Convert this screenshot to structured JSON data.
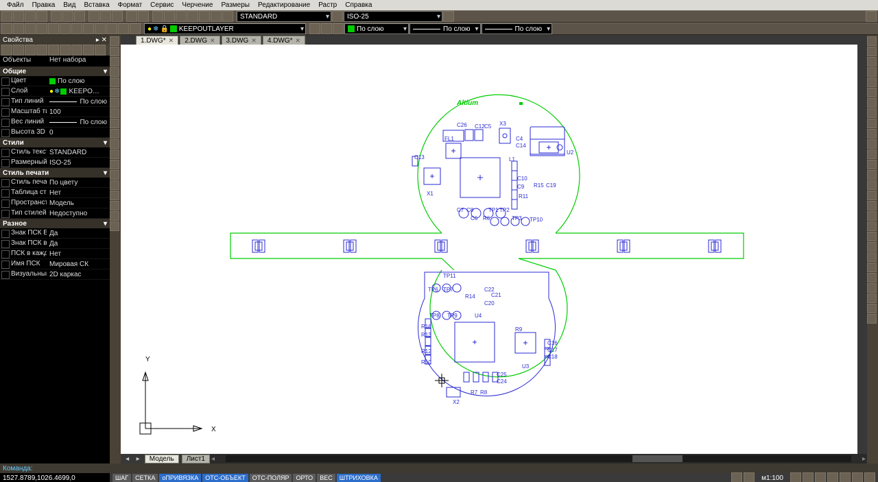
{
  "menu": [
    "Файл",
    "Правка",
    "Вид",
    "Вставка",
    "Формат",
    "Сервис",
    "Черчение",
    "Размеры",
    "Редактирование",
    "Растр",
    "Справка"
  ],
  "toolbar2": {
    "style_combo": "STANDARD",
    "dim_combo": "ISO-25"
  },
  "toolbar3": {
    "layer": "KEEPOUTLAYER",
    "bylayer": "По слою",
    "linetype": "По слою",
    "lineweight": "По слою"
  },
  "panel": {
    "title": "Свойства",
    "objects_lbl": "Объекты",
    "objects_val": "Нет набора",
    "sections": {
      "general": "Общие",
      "styles": "Стили",
      "plotstyle": "Стиль печати",
      "misc": "Разное"
    },
    "general": [
      {
        "k": "Цвет",
        "v": "По слою",
        "swatch": "#0c0"
      },
      {
        "k": "Слой",
        "v": "KEEPO…",
        "swatch": "#0c0",
        "layer": true
      },
      {
        "k": "Тип линий",
        "v": "По слою",
        "line": true
      },
      {
        "k": "Масштаб типа …",
        "v": "100"
      },
      {
        "k": "Вес линий",
        "v": "По слою",
        "line": true
      },
      {
        "k": "Высота 3D",
        "v": "0"
      }
    ],
    "styles": [
      {
        "k": "Стиль текста",
        "v": "STANDARD"
      },
      {
        "k": "Размерный ст…",
        "v": "ISO-25"
      }
    ],
    "plotstyle": [
      {
        "k": "Стиль печати",
        "v": "По цвету"
      },
      {
        "k": "Таблица стиле…",
        "v": "Нет"
      },
      {
        "k": "Пространство …",
        "v": "Модель"
      },
      {
        "k": "Тип стилей печ…",
        "v": "Недоступно"
      }
    ],
    "misc": [
      {
        "k": "Знак ПСК Вкл",
        "v": "Да"
      },
      {
        "k": "Знак ПСК в на…",
        "v": "Да"
      },
      {
        "k": "ПСК в каждом …",
        "v": "Нет"
      },
      {
        "k": "Имя ПСК",
        "v": "Мировая СК"
      },
      {
        "k": "Визуальный ст…",
        "v": "2D каркас"
      }
    ]
  },
  "tabs": [
    {
      "label": "1.DWG*",
      "active": true
    },
    {
      "label": "2.DWG"
    },
    {
      "label": "3.DWG"
    },
    {
      "label": "4.DWG*"
    }
  ],
  "bottom_tabs": [
    {
      "label": "Модель",
      "active": true
    },
    {
      "label": "Лист1"
    }
  ],
  "drawing": {
    "brand": "Altium",
    "axes": {
      "x": "X",
      "y": "Y"
    },
    "top_refs": [
      "C26",
      "FL1",
      "C12",
      "C5",
      "X3",
      "C4",
      "C14",
      "U2",
      "C13",
      "L1",
      "X1",
      "C10",
      "C9",
      "R15",
      "C19",
      "R11",
      "C7",
      "C8",
      "R6",
      "C6",
      "TP1",
      "TP2",
      "TP10",
      "TP3"
    ],
    "bot_refs": [
      "TP11",
      "TP6",
      "TP7",
      "R14",
      "C22",
      "C21",
      "C20",
      "TP8",
      "TP9",
      "U4",
      "R16",
      "R13",
      "R10",
      "R12",
      "R9",
      "C16",
      "C17",
      "C18",
      "U3",
      "C25",
      "C24",
      "R7",
      "R8",
      "X2"
    ]
  },
  "cmd": {
    "label": "Команда:"
  },
  "coord": "1527.8789,1026.4699,0",
  "status": {
    "buttons": [
      {
        "t": "ШАГ"
      },
      {
        "t": "СЕТКА"
      },
      {
        "t": "оПРИВЯЗКА",
        "on": true
      },
      {
        "t": "ОТС-ОБЪЕКТ",
        "on": true
      },
      {
        "t": "ОТС-ПОЛЯР"
      },
      {
        "t": "ОРТО"
      },
      {
        "t": "ВЕС"
      },
      {
        "t": "ШТРИХОВКА",
        "on": true
      }
    ],
    "scale": "м1:100"
  }
}
